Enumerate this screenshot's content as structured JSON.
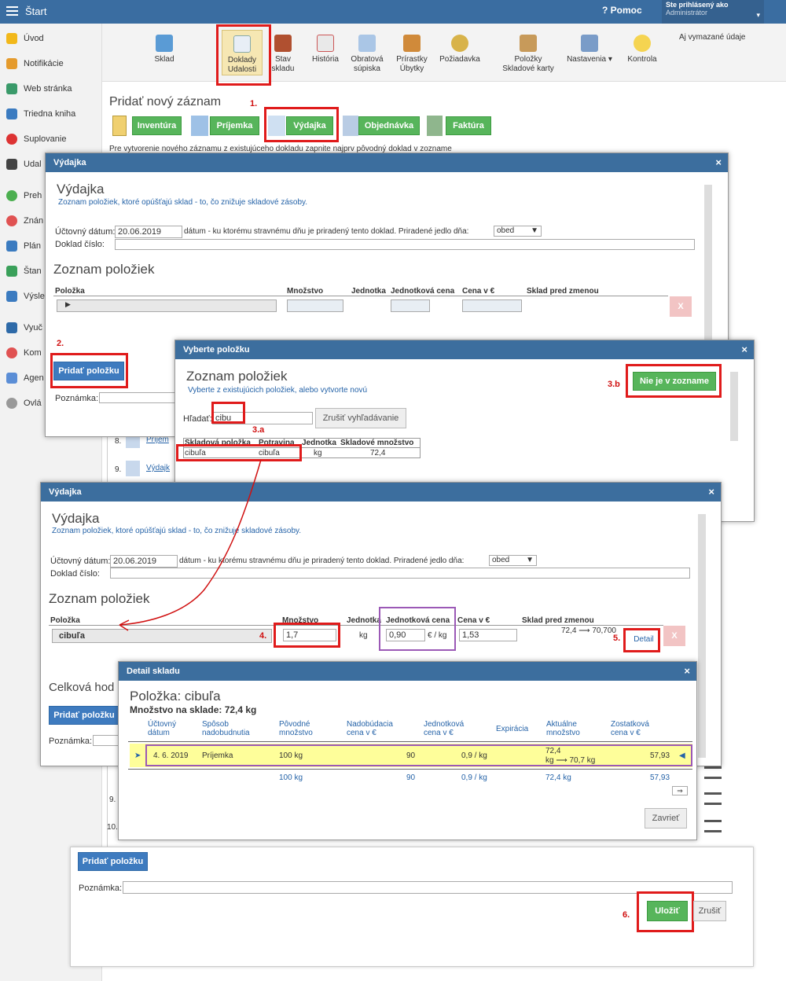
{
  "topbar": {
    "title": "Štart",
    "help": "Pomoc",
    "user_line1": "Ste prihlásený ako",
    "user_line2": "Administrátor"
  },
  "sidebar": [
    "Úvod",
    "Notifikácie",
    "Web stránka",
    "Triedna kniha",
    "Suplovanie",
    "Udal",
    "Preh",
    "Znán",
    "Plán",
    "Štan",
    "Výsle",
    "Vyuč",
    "Kom",
    "Agen",
    "Ovlá"
  ],
  "toolbar": {
    "sklad": "Sklad",
    "doklady1": "Doklady",
    "doklady2": "Udalosti",
    "stav1": "Stav",
    "stav2": "skladu",
    "historia": "História",
    "obrat1": "Obratová",
    "obrat2": "súpiska",
    "prir1": "Prírastky",
    "prir2": "Úbytky",
    "poziadavka": "Požiadavka",
    "pol1": "Položky",
    "pol2": "Skladové karty",
    "nastavenia": "Nastavenia",
    "kontrola": "Kontrola",
    "vymazane": "Aj vymazané údaje"
  },
  "main": {
    "pridat_title": "Pridať nový záznam",
    "inventura": "Inventúra",
    "prijemka": "Príjemka",
    "vydajka": "Výdajka",
    "objednavka": "Objednávka",
    "faktura": "Faktúra",
    "hint": "Pre vytvorenie nového záznamu z existujúceho dokladu zapnite najprv pôvodný doklad v zozname",
    "row8": "8.",
    "row9": "9.",
    "row9b": "9.",
    "row10": "10.",
    "row8_link": "Príjem",
    "row9_link": "Výdajk"
  },
  "steps": {
    "s1": "1.",
    "s2": "2.",
    "s3a": "3.a",
    "s3b": "3.b",
    "s4": "4.",
    "s5": "5.",
    "s6": "6."
  },
  "vydajka1": {
    "header": "Výdajka",
    "title": "Výdajka",
    "subtitle": "Zoznam položiek, ktoré opúšťajú sklad - to, čo znižuje skladové zásoby.",
    "datum_label": "Účtovný dátum:",
    "datum": "20.06.2019",
    "datum_hint": "dátum - ku ktorému stravnému dňu je priradený tento doklad. Priradené jedlo dňa:",
    "jedlo": "obed",
    "doklad_label": "Doklad číslo:",
    "zoznam": "Zoznam položiek",
    "col_polozka": "Položka",
    "col_mnozstvo": "Množstvo",
    "col_jednotka": "Jednotka",
    "col_jcena": "Jednotková cena",
    "col_cena": "Cena v €",
    "col_sklad": "Sklad pred zmenou",
    "x": "X",
    "add_btn": "Pridať položku",
    "poznamka": "Poznámka:"
  },
  "vyberte": {
    "header": "Vyberte položku",
    "title": "Zoznam položiek",
    "subtitle": "Vyberte z existujúcich položiek, alebo vytvorte novú",
    "nie_btn": "Nie je v zozname",
    "hladat_label": "Hľadať:",
    "hladat_value": "cibu",
    "zrusit_btn": "Zrušiť vyhľadávanie",
    "cols": [
      "Skladová položka",
      "Potravina",
      "Jednotka",
      "Skladové množstvo"
    ],
    "row": [
      "cibuľa",
      "cibuľa",
      "kg",
      "72,4"
    ]
  },
  "vydajka2": {
    "header": "Výdajka",
    "title": "Výdajka",
    "subtitle": "Zoznam položiek, ktoré opúšťajú sklad - to, čo znižuje skladové zásoby.",
    "datum_label": "Účtovný dátum:",
    "datum": "20.06.2019",
    "datum_hint": "dátum - ku ktorému stravnému dňu je priradený tento doklad. Priradené jedlo dňa:",
    "jedlo": "obed",
    "doklad_label": "Doklad číslo:",
    "zoznam": "Zoznam položiek",
    "col_polozka": "Položka",
    "col_mnozstvo": "Množstvo",
    "col_jednotka": "Jednotka",
    "col_jcena": "Jednotková cena",
    "col_cena": "Cena v €",
    "col_sklad": "Sklad pred zmenou",
    "item": "cibuľa",
    "mnozstvo": "1,7",
    "jednotka": "kg",
    "jcena": "0,90",
    "jcena_unit": "€ / kg",
    "cena": "1,53",
    "sklad_zmena": "72,4 ⟶ 70,700",
    "detail_btn": "Detail",
    "x": "X",
    "celkova": "Celková hod",
    "add_btn": "Pridať položku",
    "poznamka": "Poznámka:"
  },
  "detail": {
    "header": "Detail skladu",
    "title": "Položka: cibuľa",
    "mnozstvo": "Množstvo na sklade: 72,4 kg",
    "cols": {
      "datum": "Účtovný dátum",
      "sposob": "Spôsob nadobudnutia",
      "povodne": "Pôvodné množstvo",
      "nadob": "Nadobúdacia cena v €",
      "jcena": "Jednotková cena v €",
      "exp": "Expirácia",
      "aktualne": "Aktuálne množstvo",
      "zostat": "Zostatková cena v €"
    },
    "row1": {
      "datum": "4. 6. 2019",
      "sposob": "Príjemka",
      "povodne": "100 kg",
      "nadob": "90",
      "jcena": "0,9 / kg",
      "akt1": "72,4",
      "akt2": "kg ⟶ 70,7 kg",
      "zostat": "57,93"
    },
    "row2": {
      "povodne": "100 kg",
      "nadob": "90",
      "jcena": "0,9 / kg",
      "akt": "72,4 kg",
      "zostat": "57,93"
    },
    "zavriet": "Zavrieť"
  },
  "bottom": {
    "add_btn": "Pridať položku",
    "poznamka": "Poznámka:",
    "ulozit": "Uložiť",
    "zrusit": "Zrušiť"
  }
}
